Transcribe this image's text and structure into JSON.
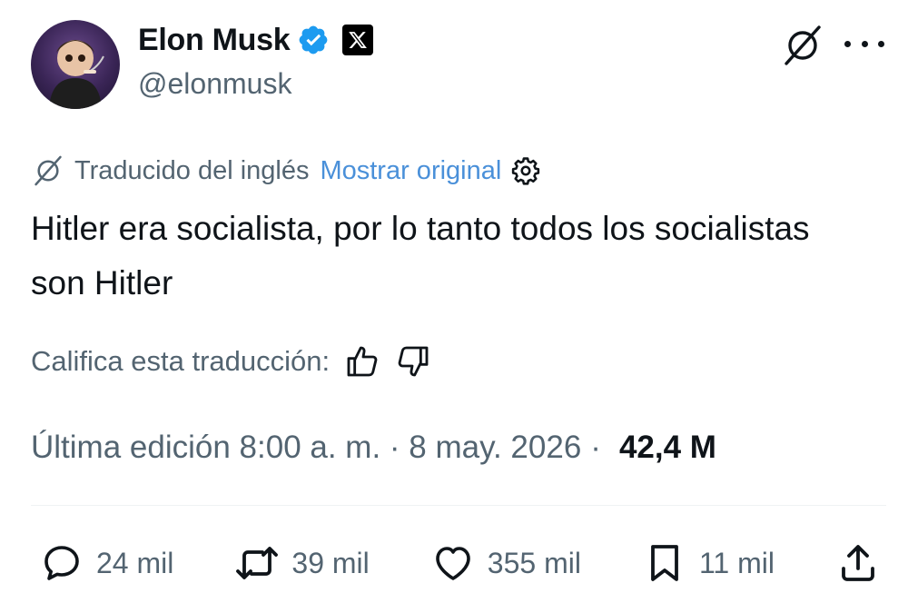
{
  "author": {
    "name": "Elon Musk",
    "handle": "@elonmusk"
  },
  "translation": {
    "label": "Traducido del inglés",
    "show_original": "Mostrar original"
  },
  "tweet": {
    "text": "Hitler era socialista, por lo tanto todos los socialistas son Hitler"
  },
  "rate": {
    "label": "Califica esta traducción:"
  },
  "meta": {
    "edited": "Última edición 8:00 a. m. · 8 may. 2026",
    "separator": "·",
    "views": "42,4 M"
  },
  "actions": {
    "replies": "24 mil",
    "reposts": "39 mil",
    "likes": "355 mil",
    "bookmarks": "11 mil"
  },
  "colors": {
    "link": "#4a90d9",
    "verified": "#1d9bf0",
    "secondary_text": "#536471",
    "primary_text": "#0f1419"
  },
  "icons": [
    "verified-badge-icon",
    "x-logo-icon",
    "grok-icon",
    "more-icon",
    "gear-icon",
    "thumbs-up-icon",
    "thumbs-down-icon",
    "reply-icon",
    "repost-icon",
    "like-icon",
    "bookmark-icon",
    "share-icon"
  ]
}
